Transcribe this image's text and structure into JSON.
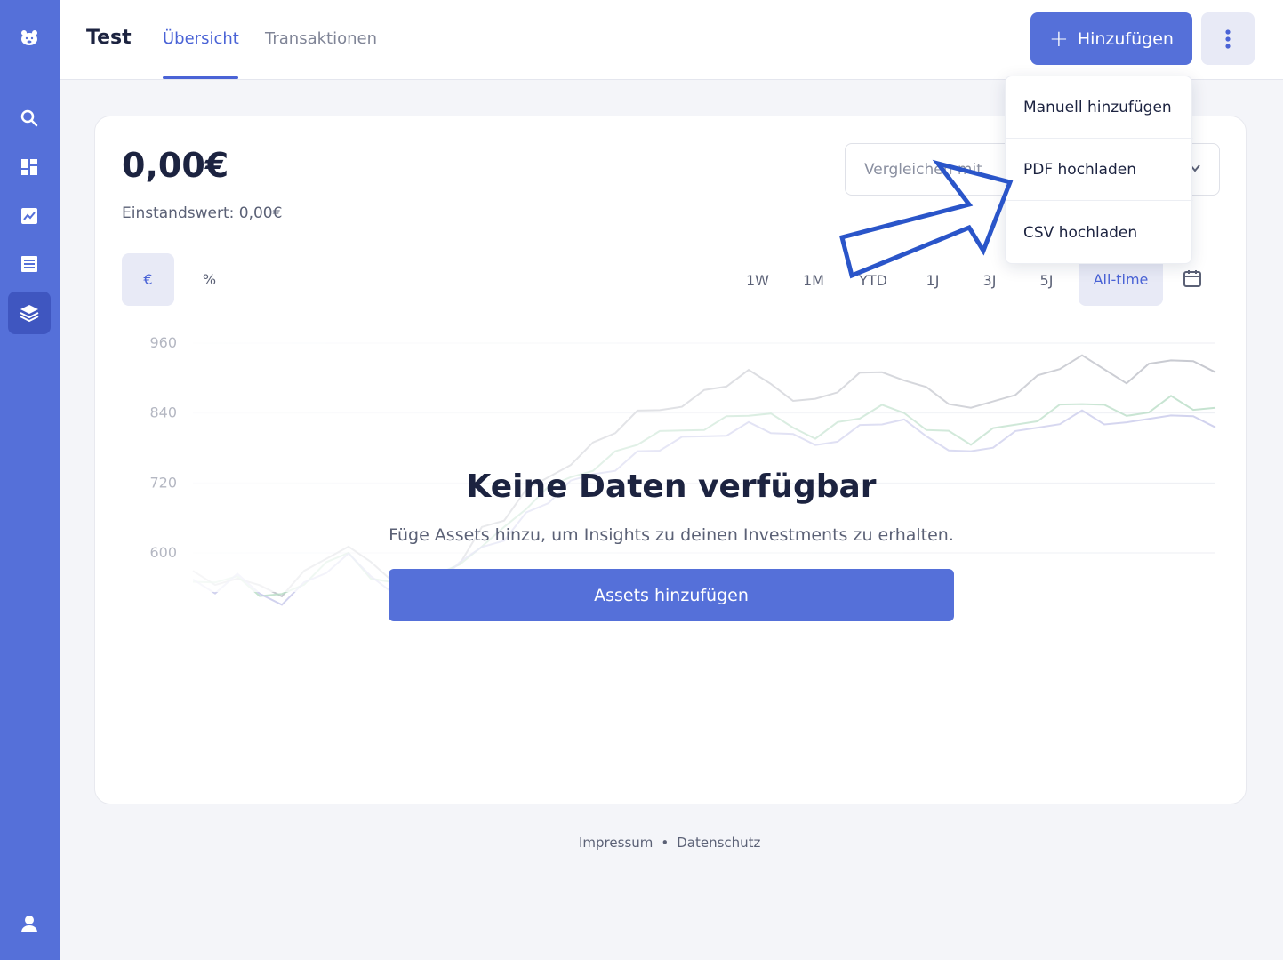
{
  "sidebar": {
    "logo_icon": "bear-logo-icon",
    "items": [
      {
        "icon": "search-icon",
        "active": false
      },
      {
        "icon": "dashboard-icon",
        "active": false
      },
      {
        "icon": "chart-line-icon",
        "active": false
      },
      {
        "icon": "list-icon",
        "active": false
      },
      {
        "icon": "layers-icon",
        "active": true
      }
    ],
    "profile_icon": "user-icon",
    "color": "#5570d9"
  },
  "header": {
    "title": "Test",
    "tabs": [
      {
        "label": "Übersicht",
        "active": true
      },
      {
        "label": "Transaktionen",
        "active": false
      }
    ],
    "add_button": {
      "plus": "+",
      "label": "Hinzufügen"
    },
    "more_icon": "vertical-dots-icon"
  },
  "card": {
    "value": "0,00€",
    "cost_basis": "Einstandswert: 0,00€",
    "compare_placeholder": "Vergleichen mit",
    "toggles": [
      {
        "label": "€",
        "active": true
      },
      {
        "label": "%",
        "active": false
      }
    ],
    "ranges": [
      {
        "label": "1W",
        "active": false
      },
      {
        "label": "1M",
        "active": false
      },
      {
        "label": "YTD",
        "active": false
      },
      {
        "label": "1J",
        "active": false
      },
      {
        "label": "3J",
        "active": false
      },
      {
        "label": "5J",
        "active": false
      },
      {
        "label": "All-time",
        "active": true
      }
    ],
    "empty_title": "Keine Daten verfügbar",
    "empty_subtitle": "Füge Assets hinzu, um Insights zu deinen Investments zu erhalten.",
    "assets_button": "Assets hinzufügen"
  },
  "chart_data": {
    "type": "line",
    "yticks": [
      "960",
      "840",
      "720",
      "600"
    ],
    "ylim": [
      600,
      960
    ],
    "grid": true,
    "series": [
      {
        "color": "#b9bbc4",
        "values": [
          560,
          545,
          565,
          540,
          530,
          560,
          590,
          620,
          580,
          555,
          545,
          560,
          590,
          640,
          660,
          700,
          730,
          760,
          785,
          810,
          835,
          845,
          860,
          875,
          890,
          905,
          890,
          870,
          860,
          880,
          900,
          910,
          905,
          880,
          860,
          840,
          860,
          880,
          900,
          920,
          930,
          915,
          900,
          920,
          935,
          920,
          910
        ]
      },
      {
        "color": "#b6dcc4",
        "values": [
          555,
          540,
          560,
          535,
          525,
          550,
          575,
          600,
          565,
          545,
          540,
          555,
          580,
          620,
          640,
          680,
          705,
          730,
          750,
          770,
          790,
          800,
          810,
          820,
          830,
          840,
          830,
          815,
          805,
          820,
          835,
          845,
          840,
          820,
          805,
          790,
          805,
          820,
          835,
          850,
          860,
          845,
          835,
          850,
          865,
          850,
          840
        ]
      },
      {
        "color": "#c5c7ea",
        "values": [
          550,
          535,
          555,
          530,
          520,
          545,
          570,
          590,
          560,
          540,
          535,
          550,
          575,
          610,
          630,
          665,
          690,
          715,
          735,
          750,
          770,
          780,
          790,
          800,
          810,
          820,
          810,
          795,
          785,
          800,
          815,
          825,
          820,
          800,
          785,
          770,
          785,
          800,
          815,
          830,
          840,
          825,
          815,
          830,
          845,
          830,
          820
        ]
      }
    ]
  },
  "dropdown": {
    "items": [
      "Manuell hinzufügen",
      "PDF hochladen",
      "CSV hochladen"
    ]
  },
  "footer": {
    "links": [
      "Impressum",
      "Datenschutz"
    ],
    "separator": "•"
  }
}
